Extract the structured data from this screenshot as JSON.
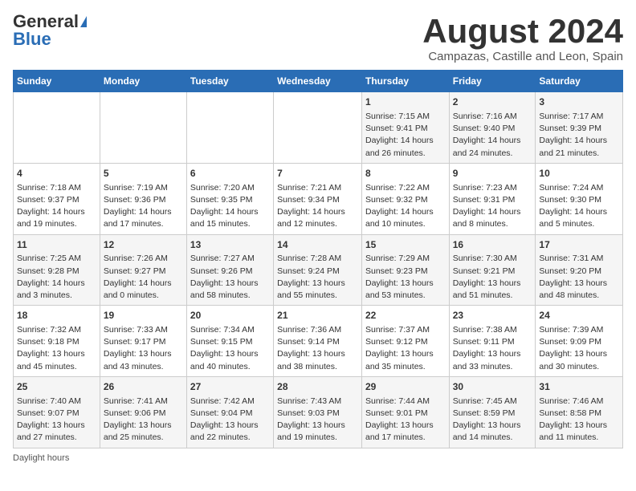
{
  "header": {
    "logo_general": "General",
    "logo_blue": "Blue",
    "month_title": "August 2024",
    "location": "Campazas, Castille and Leon, Spain"
  },
  "days_of_week": [
    "Sunday",
    "Monday",
    "Tuesday",
    "Wednesday",
    "Thursday",
    "Friday",
    "Saturday"
  ],
  "weeks": [
    [
      {
        "day": "",
        "info": ""
      },
      {
        "day": "",
        "info": ""
      },
      {
        "day": "",
        "info": ""
      },
      {
        "day": "",
        "info": ""
      },
      {
        "day": "1",
        "info": "Sunrise: 7:15 AM\nSunset: 9:41 PM\nDaylight: 14 hours and 26 minutes."
      },
      {
        "day": "2",
        "info": "Sunrise: 7:16 AM\nSunset: 9:40 PM\nDaylight: 14 hours and 24 minutes."
      },
      {
        "day": "3",
        "info": "Sunrise: 7:17 AM\nSunset: 9:39 PM\nDaylight: 14 hours and 21 minutes."
      }
    ],
    [
      {
        "day": "4",
        "info": "Sunrise: 7:18 AM\nSunset: 9:37 PM\nDaylight: 14 hours and 19 minutes."
      },
      {
        "day": "5",
        "info": "Sunrise: 7:19 AM\nSunset: 9:36 PM\nDaylight: 14 hours and 17 minutes."
      },
      {
        "day": "6",
        "info": "Sunrise: 7:20 AM\nSunset: 9:35 PM\nDaylight: 14 hours and 15 minutes."
      },
      {
        "day": "7",
        "info": "Sunrise: 7:21 AM\nSunset: 9:34 PM\nDaylight: 14 hours and 12 minutes."
      },
      {
        "day": "8",
        "info": "Sunrise: 7:22 AM\nSunset: 9:32 PM\nDaylight: 14 hours and 10 minutes."
      },
      {
        "day": "9",
        "info": "Sunrise: 7:23 AM\nSunset: 9:31 PM\nDaylight: 14 hours and 8 minutes."
      },
      {
        "day": "10",
        "info": "Sunrise: 7:24 AM\nSunset: 9:30 PM\nDaylight: 14 hours and 5 minutes."
      }
    ],
    [
      {
        "day": "11",
        "info": "Sunrise: 7:25 AM\nSunset: 9:28 PM\nDaylight: 14 hours and 3 minutes."
      },
      {
        "day": "12",
        "info": "Sunrise: 7:26 AM\nSunset: 9:27 PM\nDaylight: 14 hours and 0 minutes."
      },
      {
        "day": "13",
        "info": "Sunrise: 7:27 AM\nSunset: 9:26 PM\nDaylight: 13 hours and 58 minutes."
      },
      {
        "day": "14",
        "info": "Sunrise: 7:28 AM\nSunset: 9:24 PM\nDaylight: 13 hours and 55 minutes."
      },
      {
        "day": "15",
        "info": "Sunrise: 7:29 AM\nSunset: 9:23 PM\nDaylight: 13 hours and 53 minutes."
      },
      {
        "day": "16",
        "info": "Sunrise: 7:30 AM\nSunset: 9:21 PM\nDaylight: 13 hours and 51 minutes."
      },
      {
        "day": "17",
        "info": "Sunrise: 7:31 AM\nSunset: 9:20 PM\nDaylight: 13 hours and 48 minutes."
      }
    ],
    [
      {
        "day": "18",
        "info": "Sunrise: 7:32 AM\nSunset: 9:18 PM\nDaylight: 13 hours and 45 minutes."
      },
      {
        "day": "19",
        "info": "Sunrise: 7:33 AM\nSunset: 9:17 PM\nDaylight: 13 hours and 43 minutes."
      },
      {
        "day": "20",
        "info": "Sunrise: 7:34 AM\nSunset: 9:15 PM\nDaylight: 13 hours and 40 minutes."
      },
      {
        "day": "21",
        "info": "Sunrise: 7:36 AM\nSunset: 9:14 PM\nDaylight: 13 hours and 38 minutes."
      },
      {
        "day": "22",
        "info": "Sunrise: 7:37 AM\nSunset: 9:12 PM\nDaylight: 13 hours and 35 minutes."
      },
      {
        "day": "23",
        "info": "Sunrise: 7:38 AM\nSunset: 9:11 PM\nDaylight: 13 hours and 33 minutes."
      },
      {
        "day": "24",
        "info": "Sunrise: 7:39 AM\nSunset: 9:09 PM\nDaylight: 13 hours and 30 minutes."
      }
    ],
    [
      {
        "day": "25",
        "info": "Sunrise: 7:40 AM\nSunset: 9:07 PM\nDaylight: 13 hours and 27 minutes."
      },
      {
        "day": "26",
        "info": "Sunrise: 7:41 AM\nSunset: 9:06 PM\nDaylight: 13 hours and 25 minutes."
      },
      {
        "day": "27",
        "info": "Sunrise: 7:42 AM\nSunset: 9:04 PM\nDaylight: 13 hours and 22 minutes."
      },
      {
        "day": "28",
        "info": "Sunrise: 7:43 AM\nSunset: 9:03 PM\nDaylight: 13 hours and 19 minutes."
      },
      {
        "day": "29",
        "info": "Sunrise: 7:44 AM\nSunset: 9:01 PM\nDaylight: 13 hours and 17 minutes."
      },
      {
        "day": "30",
        "info": "Sunrise: 7:45 AM\nSunset: 8:59 PM\nDaylight: 13 hours and 14 minutes."
      },
      {
        "day": "31",
        "info": "Sunrise: 7:46 AM\nSunset: 8:58 PM\nDaylight: 13 hours and 11 minutes."
      }
    ]
  ],
  "footer": {
    "note": "Daylight hours"
  }
}
